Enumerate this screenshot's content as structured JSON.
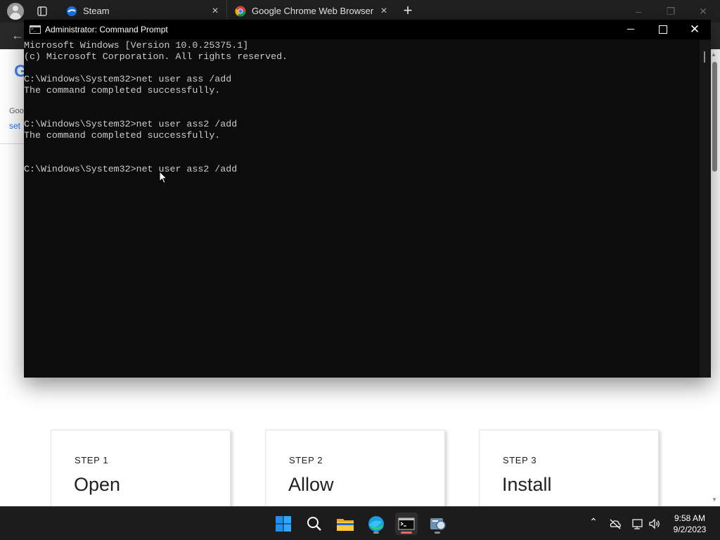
{
  "browser": {
    "tabs": [
      {
        "label": "Steam"
      },
      {
        "label": "Google Chrome Web Browser"
      }
    ],
    "new_tab_label": "+",
    "sidebar": {
      "logo_letter": "G",
      "text1": "Goo",
      "text2": "set"
    },
    "steps": [
      {
        "label": "STEP 1",
        "title": "Open"
      },
      {
        "label": "STEP 2",
        "title": "Allow"
      },
      {
        "label": "STEP 3",
        "title": "Install"
      }
    ]
  },
  "cmd_window": {
    "title": "Administrator: Command Prompt",
    "lines": [
      "Microsoft Windows [Version 10.0.25375.1]",
      "(c) Microsoft Corporation. All rights reserved.",
      "",
      "C:\\Windows\\System32>net user ass /add",
      "The command completed successfully.",
      "",
      "",
      "C:\\Windows\\System32>net user ass2 /add",
      "The command completed successfully.",
      "",
      "",
      "C:\\Windows\\System32>net user ass2 /add"
    ]
  },
  "taskbar": {
    "apps": [
      {
        "name": "start-icon"
      },
      {
        "name": "search-icon"
      },
      {
        "name": "file-explorer-icon"
      },
      {
        "name": "edge-icon"
      },
      {
        "name": "terminal-icon"
      },
      {
        "name": "app-icon"
      }
    ],
    "time": "9:58 AM",
    "date": "9/2/2023"
  },
  "colors": {
    "console_bg": "#0c0c0c",
    "console_text": "#cccccc",
    "taskbar_bg": "#1c1c1c",
    "accent_blue": "#0078d4"
  }
}
